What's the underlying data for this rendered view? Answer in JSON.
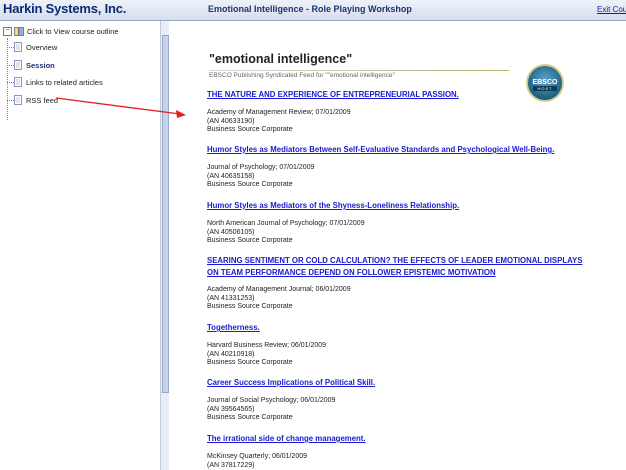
{
  "header": {
    "app_title": "Harkin Systems, Inc.",
    "page_title": "Emotional Intelligence - Role Playing Workshop",
    "exit_label": "Exit Course"
  },
  "sidebar": {
    "root_label": "Click to View course outline",
    "items": [
      {
        "label": "Overview"
      },
      {
        "label": "Session"
      },
      {
        "label": "Links to related articles"
      },
      {
        "label": "RSS feed"
      }
    ]
  },
  "feed": {
    "title": "\"emotional intelligence\"",
    "subtitle": "EBSCO Publishing Syndicated Feed for \"\"emotional intelligence\"",
    "logo_text_top": "EBSCO",
    "logo_text_bottom": "HOST"
  },
  "articles": [
    {
      "title": "THE NATURE AND EXPERIENCE OF ENTREPRENEURIAL PASSION.",
      "source": "Academy of Management Review; 07/01/2009",
      "an": "(AN 40633190)",
      "db": "Business Source Corporate"
    },
    {
      "title": "Humor Styles as Mediators Between Self-Evaluative Standards and Psychological Well-Being.",
      "source": "Journal of Psychology; 07/01/2009",
      "an": "(AN 40635158)",
      "db": "Business Source Corporate"
    },
    {
      "title": "Humor Styles as Mediators of the Shyness-Loneliness Relationship.",
      "source": "North American Journal of Psychology; 07/01/2009",
      "an": "(AN 40506105)",
      "db": "Business Source Corporate"
    },
    {
      "title": "SEARING SENTIMENT OR COLD CALCULATION? THE EFFECTS OF LEADER EMOTIONAL DISPLAYS",
      "title2": "ON TEAM PERFORMANCE DEPEND ON FOLLOWER EPISTEMIC MOTIVATION",
      "source": "Academy of Management Journal; 06/01/2009",
      "an": "(AN 41331253)",
      "db": "Business Source Corporate"
    },
    {
      "title": "Togetherness.",
      "source": "Harvard Business Review; 06/01/2009",
      "an": "(AN 40210918)",
      "db": "Business Source Corporate"
    },
    {
      "title": "Career Success Implications of Political Skill.",
      "source": "Journal of Social Psychology; 06/01/2009",
      "an": "(AN 39564565)",
      "db": "Business Source Corporate"
    },
    {
      "title": "The irrational side of change management.",
      "source": "McKinsey Quarterly; 06/01/2009",
      "an": "(AN 37817229)",
      "db": ""
    }
  ],
  "colors": {
    "link": "#1a1ad0",
    "brand": "#0b2a75",
    "annotation_arrow": "#e02020"
  }
}
